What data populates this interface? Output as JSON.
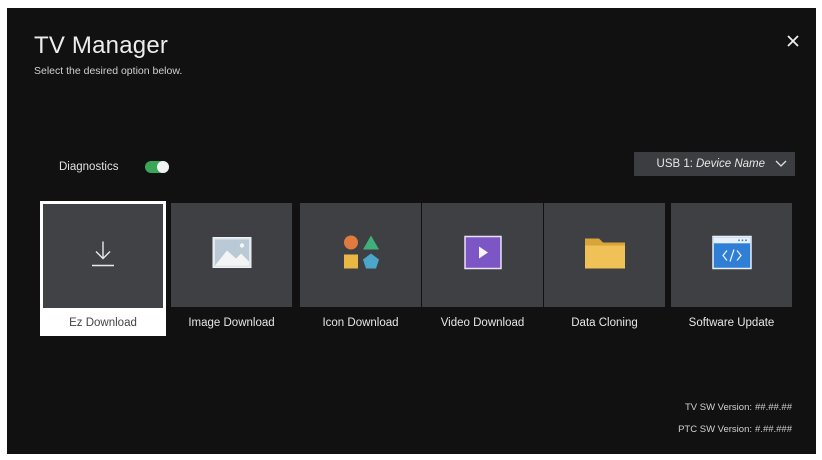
{
  "header": {
    "title": "TV Manager",
    "subtitle": "Select the desired option below."
  },
  "icons": {
    "close": "close-icon"
  },
  "diagnostics": {
    "label": "Diagnostics",
    "enabled": true,
    "toggle_color": "#3aa659"
  },
  "usb": {
    "prefix": "USB 1:",
    "device_name": "Device Name"
  },
  "tiles": [
    {
      "label": "Ez Download",
      "icon": "download-arrow-icon",
      "focused": true
    },
    {
      "label": "Image Download",
      "icon": "image-landscape-icon",
      "focused": false
    },
    {
      "label": "Icon Download",
      "icon": "shapes-icon",
      "focused": false
    },
    {
      "label": "Video Download",
      "icon": "video-play-icon",
      "focused": false
    },
    {
      "label": "Data Cloning",
      "icon": "folder-icon",
      "focused": false
    },
    {
      "label": "Software Update",
      "icon": "code-window-icon",
      "focused": false
    }
  ],
  "versions": {
    "tv_label": "TV SW Version:",
    "tv_value": "##.##.##",
    "ptc_label": "PTC SW Version:",
    "ptc_value": "#.##.###"
  }
}
